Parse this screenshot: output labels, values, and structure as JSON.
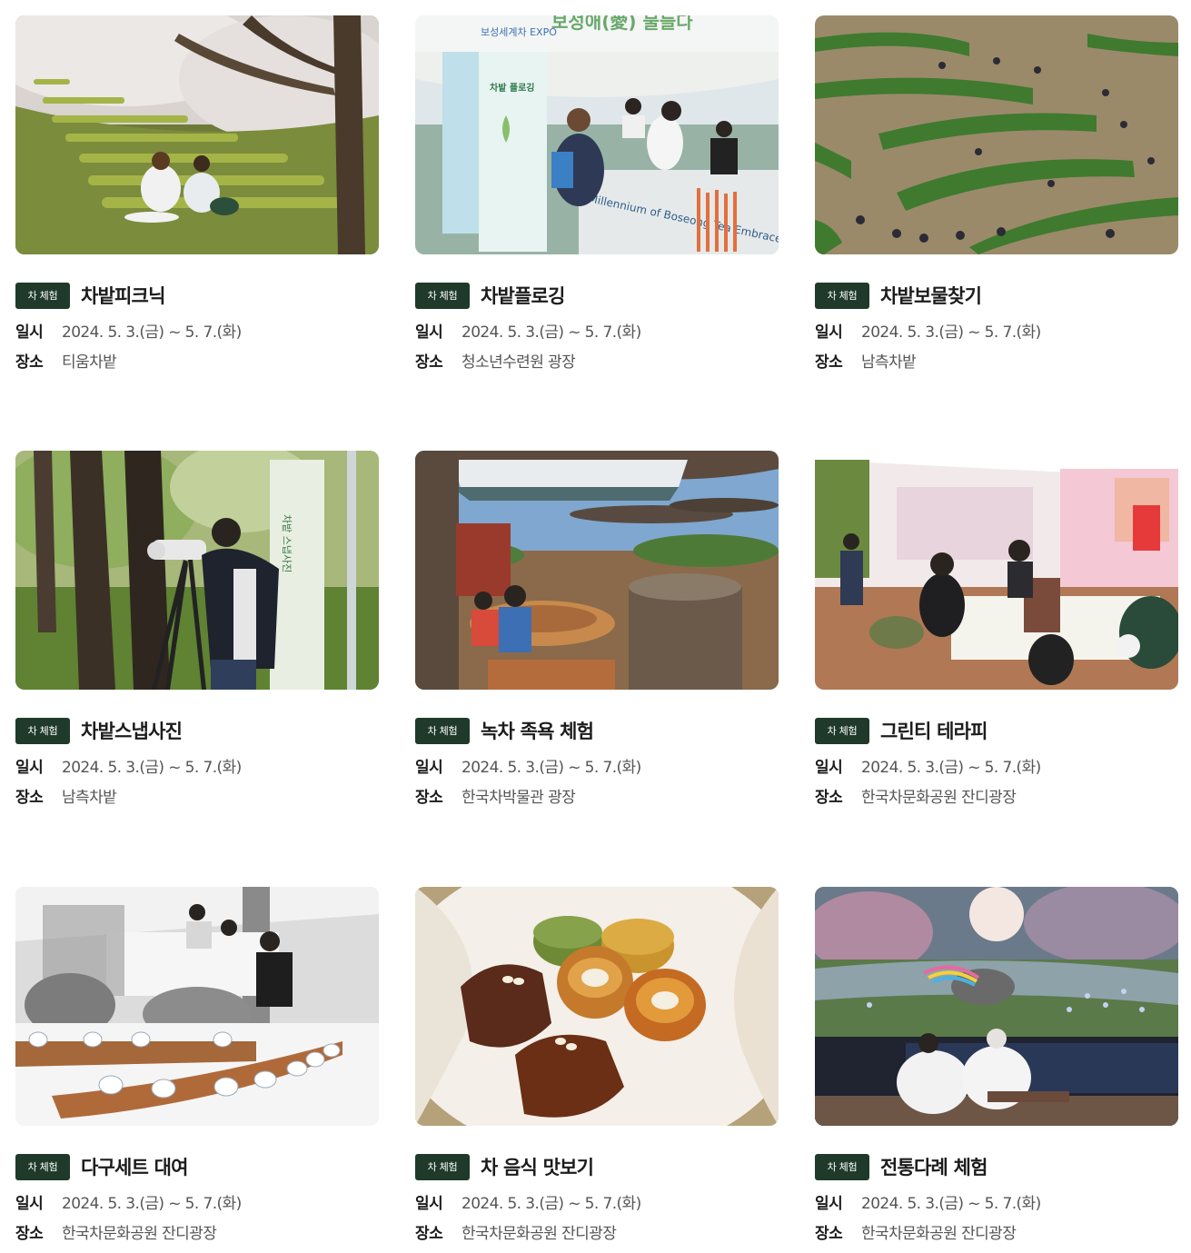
{
  "cards": [
    {
      "badge": "차 체험",
      "title": "차밭피크닉",
      "date_label": "일시",
      "date": "2024. 5. 3.(금) ~ 5. 7.(화)",
      "place_label": "장소",
      "place": "티움차밭"
    },
    {
      "badge": "차 체험",
      "title": "차밭플로깅",
      "date_label": "일시",
      "date": "2024. 5. 3.(금) ~ 5. 7.(화)",
      "place_label": "장소",
      "place": "청소년수련원 광장"
    },
    {
      "badge": "차 체험",
      "title": "차밭보물찾기",
      "date_label": "일시",
      "date": "2024. 5. 3.(금) ~ 5. 7.(화)",
      "place_label": "장소",
      "place": "남측차밭"
    },
    {
      "badge": "차 체험",
      "title": "차밭스냅사진",
      "date_label": "일시",
      "date": "2024. 5. 3.(금) ~ 5. 7.(화)",
      "place_label": "장소",
      "place": "남측차밭"
    },
    {
      "badge": "차 체험",
      "title": "녹차 족욕 체험",
      "date_label": "일시",
      "date": "2024. 5. 3.(금) ~ 5. 7.(화)",
      "place_label": "장소",
      "place": "한국차박물관 광장"
    },
    {
      "badge": "차 체험",
      "title": "그린티 테라피",
      "date_label": "일시",
      "date": "2024. 5. 3.(금) ~ 5. 7.(화)",
      "place_label": "장소",
      "place": "한국차문화공원 잔디광장"
    },
    {
      "badge": "차 체험",
      "title": "다구세트 대여",
      "date_label": "일시",
      "date": "2024. 5. 3.(금) ~ 5. 7.(화)",
      "place_label": "장소",
      "place": "한국차문화공원 잔디광장"
    },
    {
      "badge": "차 체험",
      "title": "차 음식 맛보기",
      "date_label": "일시",
      "date": "2024. 5. 3.(금) ~ 5. 7.(화)",
      "place_label": "장소",
      "place": "한국차문화공원 잔디광장"
    },
    {
      "badge": "차 체험",
      "title": "전통다례 체험",
      "date_label": "일시",
      "date": "2024. 5. 3.(금) ~ 5. 7.(화)",
      "place_label": "장소",
      "place": "한국차문화공원 잔디광장"
    }
  ],
  "photo_texts": {
    "expo_logo": "보성세계차 EXPO",
    "expo_banner_title": "보성애(愛) 물들다",
    "plogging_sign": "차밭 플로깅",
    "booth_text": "Millennium of Boseong Tea Embraces the World",
    "snap_banner": "차밭 스냅사진"
  }
}
